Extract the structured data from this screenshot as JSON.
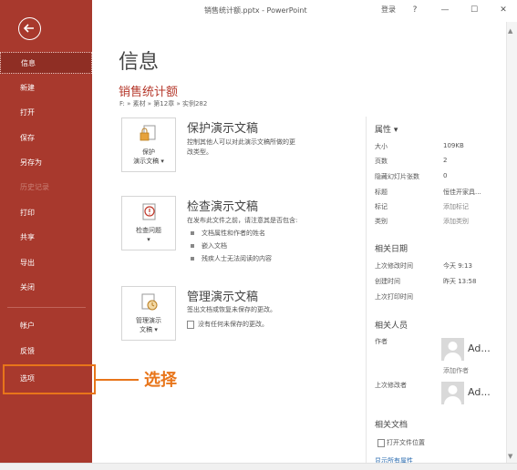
{
  "window": {
    "title": "销售统计额.pptx - PowerPoint",
    "login": "登录",
    "help": "?",
    "minimize": "—",
    "maximize": "☐",
    "close": "✕"
  },
  "sidebar": {
    "items": [
      {
        "label": "信息"
      },
      {
        "label": "新建"
      },
      {
        "label": "打开"
      },
      {
        "label": "保存"
      },
      {
        "label": "另存为"
      },
      {
        "label": "历史记录"
      },
      {
        "label": "打印"
      },
      {
        "label": "共享"
      },
      {
        "label": "导出"
      },
      {
        "label": "关闭"
      },
      {
        "label": "帐户"
      },
      {
        "label": "反馈"
      },
      {
        "label": "选项"
      }
    ]
  },
  "callout": {
    "text": "选择"
  },
  "main": {
    "title": "信息",
    "file_name": "销售统计额",
    "path": "F: » 素材 » 第12章 » 实例282",
    "sections": [
      {
        "card_label_1": "保护",
        "card_label_2": "演示文稿 ▾",
        "title": "保护演示文稿",
        "desc_1": "控制其他人可以对此演示文稿所做的更",
        "desc_2": "改类型。"
      },
      {
        "card_label_1": "检查问题",
        "card_label_2": "▾",
        "title": "检查演示文稿",
        "desc_1": "在发布此文件之前，请注意其是否包含:",
        "bullets": [
          "文档属性和作者的姓名",
          "嵌入文档",
          "残疾人士无法阅读的内容"
        ]
      },
      {
        "card_label_1": "管理演示",
        "card_label_2": "文稿 ▾",
        "title": "管理演示文稿",
        "desc_1": "签出文档或恢复未保存的更改。",
        "note": "没有任何未保存的更改。"
      }
    ]
  },
  "properties": {
    "heading": "属性 ▾",
    "rows": [
      {
        "key": "大小",
        "value": "109KB"
      },
      {
        "key": "页数",
        "value": "2"
      },
      {
        "key": "隐藏幻灯片张数",
        "value": "0"
      },
      {
        "key": "标题",
        "value": "恒佳开家具..."
      },
      {
        "key": "标记",
        "value": "添加标记"
      },
      {
        "key": "类别",
        "value": "添加类别"
      }
    ]
  },
  "dates": {
    "heading": "相关日期",
    "rows": [
      {
        "key": "上次修改时间",
        "value": "今天 9:13"
      },
      {
        "key": "创建时间",
        "value": "昨天 13:58"
      },
      {
        "key": "上次打印时间",
        "value": ""
      }
    ]
  },
  "people": {
    "heading": "相关人员",
    "author_label": "作者",
    "author_name": "Ad...",
    "add_author": "添加作者",
    "last_modified_label": "上次修改者",
    "last_modified_name": "Ad..."
  },
  "documents": {
    "heading": "相关文档",
    "open_location": "打开文件位置",
    "more": "显示所有属性"
  }
}
